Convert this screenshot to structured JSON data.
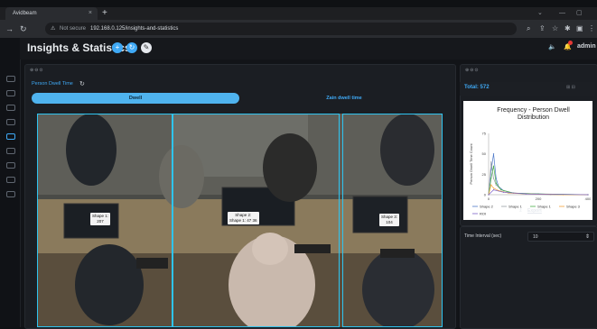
{
  "browser": {
    "tab_title": "Avidbeam",
    "tab_close": "×",
    "new_tab": "+",
    "insecure_label": "Not secure",
    "url": "192.168.0.125/insights-and-statistics",
    "win_min": "—",
    "win_max": "▢",
    "win_restore": "⌄"
  },
  "header": {
    "title": "Insights & Statistics",
    "user": "admin",
    "notification_count": "1"
  },
  "left_panel": {
    "controls": "⊕⊖⊙",
    "title": "Person Dwell Time",
    "tabs": [
      {
        "label": "Dwell",
        "active": true
      },
      {
        "label": "Zain dwell time",
        "active": false
      }
    ],
    "shape_labels": [
      {
        "line1": "Shape 1:",
        "line2": "207"
      },
      {
        "line1": "Shape 2:",
        "line2": "Shape 1: 47 36"
      },
      {
        "line1": "Shape 3:",
        "line2": "104"
      }
    ]
  },
  "right_panel": {
    "controls": "⊕⊖⊙",
    "total_label": "Total: 572",
    "export_label": "Export",
    "interval_label": "Time Interval (sec)",
    "interval_value": "10"
  },
  "chart_data": {
    "type": "line",
    "title": "Frequency - Person Dwell Time Distribution",
    "xlabel": "",
    "ylabel": "Person Dwell Time Count",
    "xlim": [
      0,
      400
    ],
    "ylim": [
      0,
      75
    ],
    "x_ticks": [
      "0",
      "200",
      "400"
    ],
    "y_ticks": [
      "0",
      "25",
      "50",
      "75"
    ],
    "legend_position": "bottom",
    "series": [
      {
        "name": "Shape 2",
        "color": "#4e79c9",
        "x": [
          0,
          10,
          20,
          30,
          40,
          60,
          100,
          200,
          300,
          400
        ],
        "values": [
          0,
          30,
          50,
          20,
          10,
          5,
          2,
          1,
          0,
          0
        ]
      },
      {
        "name": "Shape 1",
        "color": "#9aa0a6",
        "x": [
          0,
          10,
          20,
          30,
          50,
          80,
          150,
          250,
          400
        ],
        "values": [
          0,
          40,
          20,
          12,
          6,
          3,
          1,
          0,
          0
        ]
      },
      {
        "name": "Shape 1",
        "color": "#49b04a",
        "x": [
          0,
          10,
          20,
          30,
          50,
          100,
          200,
          400
        ],
        "values": [
          0,
          20,
          35,
          14,
          6,
          2,
          1,
          0
        ]
      },
      {
        "name": "Shape 3",
        "color": "#f2a43b",
        "x": [
          0,
          10,
          20,
          40,
          80,
          150,
          300,
          400
        ],
        "values": [
          0,
          12,
          8,
          5,
          2,
          1,
          0,
          0
        ]
      },
      {
        "name": "ROI",
        "color": "#7b61c9",
        "x": [
          0,
          20,
          60,
          150,
          400
        ],
        "values": [
          0,
          6,
          3,
          1,
          0
        ]
      }
    ]
  },
  "colors": {
    "accent": "#3fa9f5",
    "roi": "#2ec4f0",
    "tab_active": "#4fb3ee"
  }
}
